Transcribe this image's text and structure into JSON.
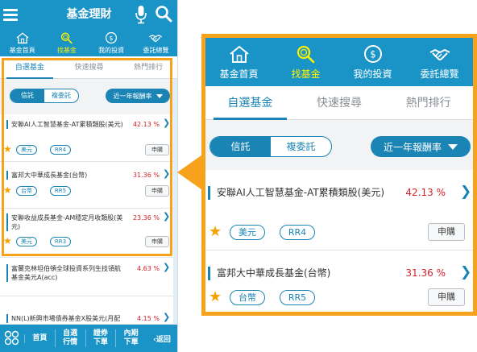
{
  "app": {
    "title": "基金理財",
    "nav": [
      {
        "label": "基金首頁",
        "icon": "home-icon"
      },
      {
        "label": "找基金",
        "icon": "search-fund-icon"
      },
      {
        "label": "我的投資",
        "icon": "coin-icon"
      },
      {
        "label": "委託總覽",
        "icon": "handshake-icon"
      }
    ],
    "active_nav": 1,
    "tabs": [
      "自選基金",
      "快速搜尋",
      "熱門排行"
    ],
    "active_tab": 0
  },
  "filter": {
    "segments": [
      "信託",
      "複委託"
    ],
    "active_segment": 0,
    "sort_label": "近一年報酬率"
  },
  "funds": [
    {
      "name": "安聯AI人工智慧基金-AT累積類股(美元)",
      "return": "42.13 %",
      "tags": [
        "美元",
        "RR4"
      ],
      "buy_label": "申購",
      "starred": true
    },
    {
      "name": "富邦大中華成長基金(台幣)",
      "return": "31.36 %",
      "tags": [
        "台幣",
        "RR5"
      ],
      "buy_label": "申購",
      "starred": true
    },
    {
      "name": "安聯收益成長基金-AM穩定月收類股(美元)",
      "return": "23.36 %",
      "tags": [
        "美元",
        "RR3"
      ],
      "buy_label": "申購",
      "starred": true
    },
    {
      "name": "富蘭克林坦伯頓全球投資系列生技領航基金美元A(acc)",
      "return": "4.63 %"
    },
    {
      "name": "NN(L)新興市場債券基金X股美元(月配",
      "return": "4.15 %"
    }
  ],
  "bottom_bar": {
    "items": [
      "首頁",
      "自選\n行情",
      "證券\n下單",
      "內期\n下單"
    ],
    "back_label": "返回"
  },
  "colors": {
    "primary": "#1a93c6",
    "accent_active": "#fff200",
    "highlight": "#f7a21c",
    "return_red": "#d6202a",
    "star": "#f5a300"
  }
}
